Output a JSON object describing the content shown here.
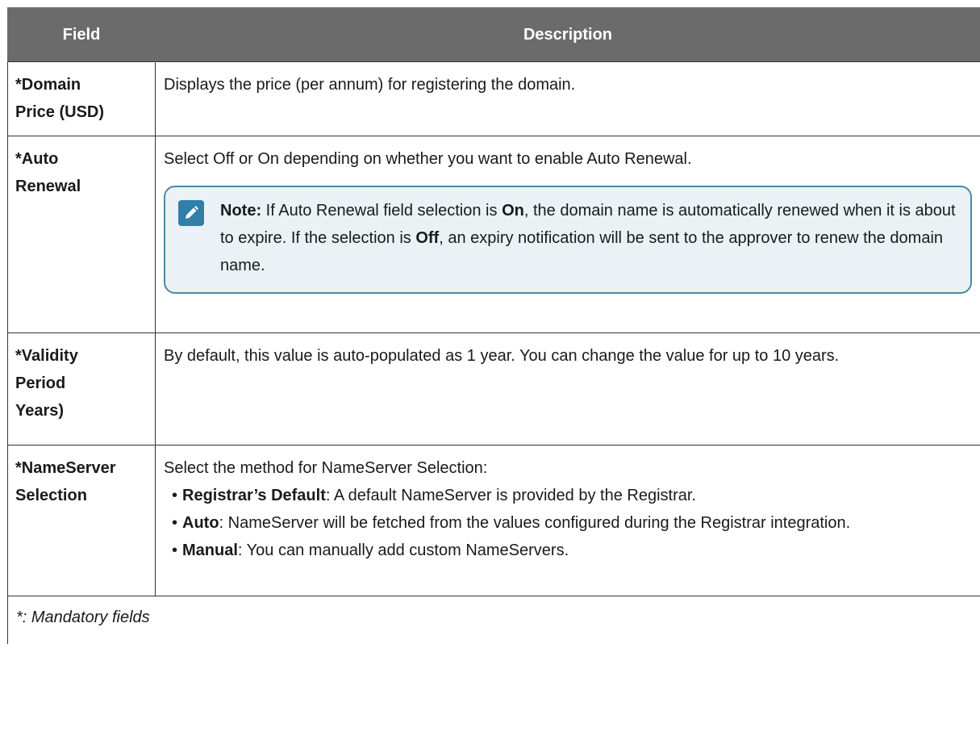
{
  "table": {
    "headers": {
      "field": "Field",
      "description": "Description"
    },
    "rows": {
      "price": {
        "field_line1": "*Domain",
        "field_line2": "Price (USD)",
        "description": "Displays the price (per annum) for registering the domain."
      },
      "renewal": {
        "field_line1": "*Auto",
        "field_line2": "Renewal",
        "description": "Select Off or On depending on whether you want to enable Auto Renewal.",
        "note": {
          "label": "Note:",
          "text1": " If Auto Renewal field selection is ",
          "on": "On",
          "text2": ", the domain name is automatically renewed when it is about to expire. If the selection is ",
          "off": "Off",
          "text3": ", an expiry notification will be sent to the approver to renew the domain name.",
          "icon": "pencil-note-icon",
          "border_color": "#4d8aa3",
          "background_color": "#eaf2f5",
          "icon_color": "#2f7fa8"
        }
      },
      "validity": {
        "field_line1": "*Validity",
        "field_line2": "Period",
        "field_line3": "Years)",
        "description": "By default, this value is auto-populated as 1 year. You can change the value for up to 10 years."
      },
      "nameserver": {
        "field_line1": "*NameServer",
        "field_line2": "Selection",
        "intro": "Select the method for NameServer Selection:",
        "items": [
          {
            "term": "Registrar’s Default",
            "text": ": A default NameServer is provided by the Registrar."
          },
          {
            "term": "Auto",
            "text": ": NameServer will be fetched from the values configured during the Registrar integration."
          },
          {
            "term": "Manual",
            "text": ": You can manually add custom NameServers."
          }
        ]
      }
    },
    "footer": "*: Mandatory fields",
    "header_color": "#6b6b6b"
  }
}
